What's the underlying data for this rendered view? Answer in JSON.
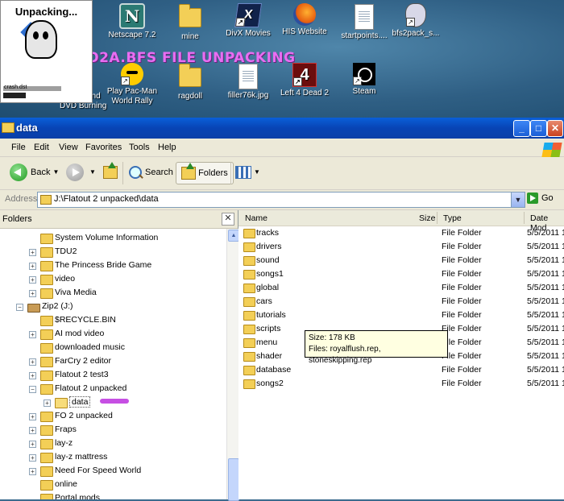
{
  "desktop": {
    "icons": [
      {
        "label": "Netscape 7.2",
        "icon": "netscape-icon",
        "shortcut": false
      },
      {
        "label": "mine",
        "icon": "folder-icon",
        "shortcut": false
      },
      {
        "label": "DivX Movies",
        "icon": "divx-icon",
        "shortcut": true
      },
      {
        "label": "HIS Website",
        "icon": "firefox-icon",
        "shortcut": false
      },
      {
        "label": "startpoints....",
        "icon": "document-icon",
        "shortcut": false
      },
      {
        "label": "bfs2pack_s...",
        "icon": "bfs-ghost-icon",
        "shortcut": true
      },
      {
        "label": "Play Pac-Man World Rally",
        "icon": "pacman-icon",
        "shortcut": true
      },
      {
        "label": "ragdoll",
        "icon": "folder-icon",
        "shortcut": false
      },
      {
        "label": "filler76k.jpg",
        "icon": "document-icon",
        "shortcut": false
      },
      {
        "label": "Left 4 Dead 2",
        "icon": "l4d2-icon",
        "shortcut": true
      },
      {
        "label": "Steam",
        "icon": "steam-icon",
        "shortcut": true
      }
    ],
    "partial_labels": [
      "er",
      "and",
      "DVD Burning"
    ],
    "banner": "FO2A.BFS FILE UNPACKING",
    "unpack_window": {
      "title": "Unpacking...",
      "filename": "crash.dst"
    }
  },
  "window": {
    "title": "data",
    "menu": [
      "File",
      "Edit",
      "View",
      "Favorites",
      "Tools",
      "Help"
    ],
    "toolbar": {
      "back": "Back",
      "search": "Search",
      "folders": "Folders"
    },
    "address": {
      "label": "Address",
      "value": "J:\\Flatout 2 unpacked\\data",
      "go": "Go"
    }
  },
  "folders_pane": {
    "title": "Folders",
    "tree": [
      {
        "label": "System Volume Information",
        "expander": "",
        "level": 0
      },
      {
        "label": "TDU2",
        "expander": "+",
        "level": 0
      },
      {
        "label": "The Princess Bride Game",
        "expander": "+",
        "level": 0
      },
      {
        "label": "video",
        "expander": "+",
        "level": 0
      },
      {
        "label": "Viva Media",
        "expander": "+",
        "level": 0
      },
      {
        "label": "Zip2 (J:)",
        "expander": "-",
        "level": -1,
        "drive": true
      },
      {
        "label": "$RECYCLE.BIN",
        "expander": "",
        "level": 1
      },
      {
        "label": "AI mod video",
        "expander": "+",
        "level": 1
      },
      {
        "label": "downloaded music",
        "expander": "",
        "level": 1
      },
      {
        "label": "FarCry 2 editor",
        "expander": "+",
        "level": 1
      },
      {
        "label": "Flatout 2 test3",
        "expander": "+",
        "level": 1
      },
      {
        "label": "Flatout 2 unpacked",
        "expander": "-",
        "level": 1
      },
      {
        "label": "data",
        "expander": "+",
        "level": 2,
        "selected": true
      },
      {
        "label": "FO 2 unpacked",
        "expander": "+",
        "level": 1
      },
      {
        "label": "Fraps",
        "expander": "+",
        "level": 1
      },
      {
        "label": "lay-z",
        "expander": "+",
        "level": 1
      },
      {
        "label": "lay-z mattress",
        "expander": "+",
        "level": 1
      },
      {
        "label": "Need For Speed World",
        "expander": "+",
        "level": 1
      },
      {
        "label": "online",
        "expander": "",
        "level": 1
      },
      {
        "label": "Portal mods",
        "expander": "",
        "level": 1
      }
    ]
  },
  "files_pane": {
    "columns": {
      "name": "Name",
      "size": "Size",
      "type": "Type",
      "date": "Date Mod"
    },
    "rows": [
      {
        "name": "tracks",
        "type": "File Folder",
        "date": "5/5/2011 1"
      },
      {
        "name": "drivers",
        "type": "File Folder",
        "date": "5/5/2011 1"
      },
      {
        "name": "sound",
        "type": "File Folder",
        "date": "5/5/2011 1"
      },
      {
        "name": "songs1",
        "type": "File Folder",
        "date": "5/5/2011 1"
      },
      {
        "name": "global",
        "type": "File Folder",
        "date": "5/5/2011 1"
      },
      {
        "name": "cars",
        "type": "File Folder",
        "date": "5/5/2011 1"
      },
      {
        "name": "tutorials",
        "type": "File Folder",
        "date": "5/5/2011 1"
      },
      {
        "name": "scripts",
        "type": "File Folder",
        "date": "5/5/2011 1"
      },
      {
        "name": "menu",
        "type": "File Folder",
        "date": "5/5/2011 1"
      },
      {
        "name": "shader",
        "type": "File Folder",
        "date": "5/5/2011 1"
      },
      {
        "name": "database",
        "type": "File Folder",
        "date": "5/5/2011 1"
      },
      {
        "name": "songs2",
        "type": "File Folder",
        "date": "5/5/2011 1"
      }
    ],
    "tooltip": {
      "line1": "Size: 178 KB",
      "line2": "Files: royalflush.rep, stoneskipping.rep"
    }
  }
}
